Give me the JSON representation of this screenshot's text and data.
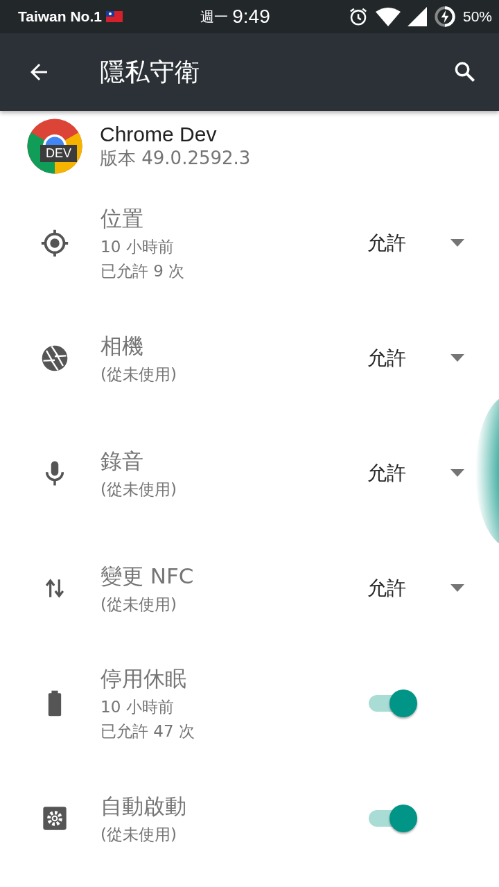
{
  "status_bar": {
    "carrier": "Taiwan No.1",
    "day": "週一",
    "time": "9:49",
    "battery": "50%"
  },
  "app_bar": {
    "title": "隱私守衛"
  },
  "app": {
    "name": "Chrome Dev",
    "version": "版本 49.0.2592.3",
    "badge": "DEV"
  },
  "permissions": [
    {
      "kind": "dropdown",
      "title": "位置",
      "lines": [
        "10 小時前",
        "已允許 9 次"
      ],
      "value": "允許"
    },
    {
      "kind": "dropdown",
      "title": "相機",
      "lines": [
        "(從未使用)"
      ],
      "value": "允許"
    },
    {
      "kind": "dropdown",
      "title": "錄音",
      "lines": [
        "(從未使用)"
      ],
      "value": "允許"
    },
    {
      "kind": "dropdown",
      "title": "變更 NFC",
      "lines": [
        "(從未使用)"
      ],
      "value": "允許"
    },
    {
      "kind": "switch",
      "title": "停用休眠",
      "lines": [
        "10 小時前",
        "已允許 47 次"
      ],
      "on": true
    },
    {
      "kind": "switch",
      "title": "自動啟動",
      "lines": [
        "(從未使用)"
      ],
      "on": true
    }
  ]
}
